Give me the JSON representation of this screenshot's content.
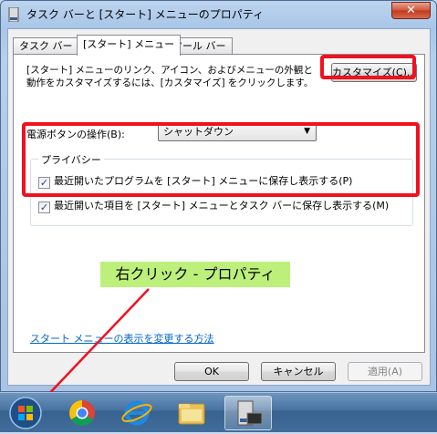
{
  "window": {
    "title": "タスク バーと [スタート] メニューのプロパティ",
    "close_glyph": "✕"
  },
  "tabs": [
    {
      "label": "タスク バー"
    },
    {
      "label": "[スタート] メニュー"
    },
    {
      "label": "ツール バー"
    }
  ],
  "start_menu_tab": {
    "description": "[スタート] メニューのリンク、アイコン、およびメニューの外観と動作をカスタマイズするには、[カスタマイズ] をクリックします。",
    "customize_label": "カスタマイズ(C)...",
    "power_button_label": "電源ボタンの操作(B):",
    "power_button_value": "シャットダウン",
    "power_button_arrow": "▼",
    "privacy": {
      "title": "プライバシー",
      "items": [
        {
          "label": "最近開いたプログラムを [スタート] メニューに保存し表示する(P)",
          "checked": true
        },
        {
          "label": "最近開いた項目を [スタート] メニューとタスク バーに保存し表示する(M)",
          "checked": true
        }
      ],
      "check_glyph": "✓"
    },
    "help_link": "スタート メニューの表示を変更する方法"
  },
  "buttons": {
    "ok": "OK",
    "cancel": "キャンセル",
    "apply": "適用(A)"
  },
  "annotation": {
    "text": "右クリック - プロパティ"
  },
  "colors": {
    "highlight": "#f0111f",
    "annotation_bg": "#bdf07b"
  },
  "taskbar": {
    "items": [
      "windows-start-orb-icon",
      "chrome-icon",
      "internet-explorer-icon",
      "file-explorer-icon",
      "taskbar-properties-window-icon"
    ]
  }
}
